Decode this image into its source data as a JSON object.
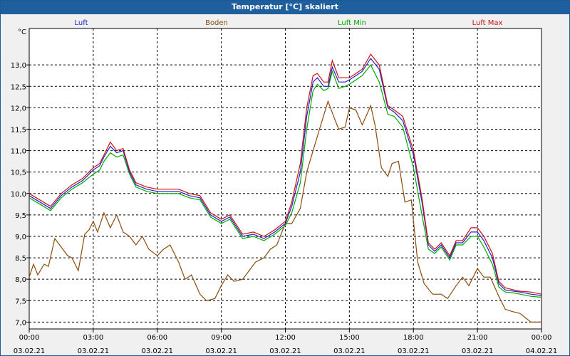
{
  "window_title": "Temperatur [°C] skaliert",
  "chart_data": {
    "type": "line",
    "title": "Temperatur [°C] skaliert",
    "ylabel": "°C",
    "xlabel": "",
    "ylim": [
      6.84,
      13.85
    ],
    "xlim_hours": [
      0,
      24
    ],
    "grid": true,
    "grid_style": "dashed",
    "legend_placement": "top",
    "y_ticks": [
      "13,0",
      "12,5",
      "12,0",
      "11,5",
      "11,0",
      "10,5",
      "10,0",
      "9,5",
      "9,0",
      "8,5",
      "8,0",
      "7,5",
      "7,0"
    ],
    "y_tick_values": [
      13.0,
      12.5,
      12.0,
      11.5,
      11.0,
      10.5,
      10.0,
      9.5,
      9.0,
      8.5,
      8.0,
      7.5,
      7.0
    ],
    "x_tick_times": [
      "00:00",
      "03:00",
      "06:00",
      "09:00",
      "12:00",
      "15:00",
      "18:00",
      "21:00",
      "00:00"
    ],
    "x_tick_dates": [
      "03.02.21",
      "03.02.21",
      "03.02.21",
      "03.02.21",
      "03.02.21",
      "03.02.21",
      "03.02.21",
      "03.02.21",
      "04.02.21"
    ],
    "x_tick_hours": [
      0,
      3,
      6,
      9,
      12,
      15,
      18,
      21,
      24
    ],
    "series": [
      {
        "name": "Luft",
        "color": "#2222cc",
        "x": [
          0,
          0.5,
          1,
          1.5,
          2,
          2.5,
          3,
          3.3,
          3.5,
          3.8,
          4.1,
          4.4,
          4.7,
          5,
          5.5,
          6,
          6.5,
          7,
          7.5,
          8,
          8.5,
          9,
          9.4,
          10,
          10.5,
          11,
          11.5,
          12,
          12.3,
          12.7,
          13,
          13.3,
          13.5,
          13.8,
          14,
          14.2,
          14.5,
          14.8,
          15,
          15.3,
          15.6,
          16,
          16.4,
          16.8,
          17.1,
          17.5,
          18,
          18.4,
          18.7,
          19,
          19.3,
          19.7,
          20,
          20.3,
          20.7,
          21,
          21.3,
          21.7,
          22,
          22.3,
          22.7,
          23,
          23.5,
          24
        ],
        "y": [
          9.95,
          9.8,
          9.65,
          9.95,
          10.15,
          10.3,
          10.55,
          10.65,
          10.85,
          11.1,
          10.95,
          11.0,
          10.5,
          10.2,
          10.1,
          10.05,
          10.05,
          10.05,
          9.95,
          9.9,
          9.5,
          9.35,
          9.45,
          9.0,
          9.05,
          8.95,
          9.1,
          9.3,
          9.7,
          10.5,
          11.8,
          12.6,
          12.7,
          12.5,
          12.5,
          12.95,
          12.6,
          12.6,
          12.65,
          12.75,
          12.85,
          13.15,
          12.9,
          12.0,
          11.9,
          11.7,
          10.9,
          9.8,
          8.8,
          8.65,
          8.8,
          8.5,
          8.85,
          8.85,
          9.1,
          9.1,
          8.9,
          8.5,
          7.9,
          7.75,
          7.72,
          7.7,
          7.65,
          7.62
        ]
      },
      {
        "name": "Boden",
        "color": "#8b4c0c",
        "x": [
          0,
          0.2,
          0.4,
          0.7,
          0.9,
          1.2,
          1.5,
          1.8,
          2,
          2.3,
          2.6,
          2.8,
          3,
          3.2,
          3.5,
          3.8,
          4.1,
          4.4,
          4.7,
          5,
          5.3,
          5.6,
          6,
          6.3,
          6.6,
          7,
          7.3,
          7.6,
          8,
          8.3,
          8.7,
          9,
          9.3,
          9.6,
          10,
          10.3,
          10.6,
          11,
          11.3,
          11.6,
          12,
          12.3,
          12.7,
          13,
          13.3,
          13.6,
          14,
          14.3,
          14.5,
          14.8,
          15,
          15.3,
          15.6,
          16,
          16.2,
          16.5,
          16.8,
          17,
          17.3,
          17.6,
          17.9,
          18.2,
          18.5,
          18.9,
          19.3,
          19.6,
          20,
          20.3,
          20.6,
          21,
          21.3,
          21.6,
          22,
          22.3,
          22.6,
          23,
          23.5,
          24
        ],
        "y": [
          8.05,
          8.35,
          8.1,
          8.35,
          8.3,
          8.95,
          8.75,
          8.55,
          8.5,
          8.2,
          9.05,
          9.15,
          9.35,
          9.1,
          9.55,
          9.2,
          9.5,
          9.1,
          9.0,
          8.8,
          9.0,
          8.7,
          8.55,
          8.7,
          8.8,
          8.4,
          8.0,
          8.1,
          7.65,
          7.5,
          7.55,
          7.85,
          8.1,
          7.95,
          8.0,
          8.2,
          8.4,
          8.5,
          8.7,
          8.8,
          9.3,
          9.3,
          9.65,
          10.5,
          11.0,
          11.5,
          12.15,
          11.75,
          11.5,
          11.55,
          12.0,
          11.95,
          11.6,
          12.05,
          11.6,
          10.6,
          10.4,
          10.7,
          10.75,
          9.8,
          9.85,
          8.4,
          7.9,
          7.65,
          7.65,
          7.55,
          7.85,
          8.05,
          7.85,
          8.25,
          8.05,
          8.05,
          7.6,
          7.3,
          7.25,
          7.2,
          7.0,
          7.0
        ]
      },
      {
        "name": "Luft Min",
        "color": "#00aa00",
        "x": [
          0,
          0.5,
          1,
          1.5,
          2,
          2.5,
          3,
          3.3,
          3.5,
          3.8,
          4.1,
          4.4,
          4.7,
          5,
          5.5,
          6,
          6.5,
          7,
          7.5,
          8,
          8.5,
          9,
          9.4,
          10,
          10.5,
          11,
          11.5,
          12,
          12.3,
          12.7,
          13,
          13.3,
          13.5,
          13.8,
          14,
          14.2,
          14.5,
          14.8,
          15,
          15.3,
          15.6,
          16,
          16.4,
          16.8,
          17.1,
          17.5,
          18,
          18.4,
          18.7,
          19,
          19.3,
          19.7,
          20,
          20.3,
          20.7,
          21,
          21.3,
          21.7,
          22,
          22.3,
          22.7,
          23,
          23.5,
          24
        ],
        "y": [
          9.9,
          9.75,
          9.6,
          9.9,
          10.1,
          10.25,
          10.45,
          10.55,
          10.75,
          10.95,
          10.85,
          10.9,
          10.45,
          10.15,
          10.05,
          10.0,
          10.0,
          10.0,
          9.9,
          9.85,
          9.45,
          9.3,
          9.4,
          8.95,
          9.0,
          8.9,
          9.05,
          9.25,
          9.55,
          10.25,
          11.5,
          12.4,
          12.55,
          12.4,
          12.45,
          12.85,
          12.45,
          12.5,
          12.55,
          12.65,
          12.75,
          13.0,
          12.6,
          11.85,
          11.8,
          11.55,
          10.6,
          9.5,
          8.7,
          8.6,
          8.75,
          8.45,
          8.8,
          8.8,
          9.0,
          9.0,
          8.75,
          8.35,
          7.82,
          7.7,
          7.68,
          7.65,
          7.6,
          7.58
        ]
      },
      {
        "name": "Luft Max",
        "color": "#cc1111",
        "x": [
          0,
          0.5,
          1,
          1.5,
          2,
          2.5,
          3,
          3.3,
          3.5,
          3.8,
          4.1,
          4.4,
          4.7,
          5,
          5.5,
          6,
          6.5,
          7,
          7.5,
          8,
          8.5,
          9,
          9.4,
          10,
          10.5,
          11,
          11.5,
          12,
          12.3,
          12.7,
          13,
          13.3,
          13.5,
          13.8,
          14,
          14.2,
          14.5,
          14.8,
          15,
          15.3,
          15.6,
          16,
          16.4,
          16.8,
          17.1,
          17.5,
          18,
          18.4,
          18.7,
          19,
          19.3,
          19.7,
          20,
          20.3,
          20.7,
          21,
          21.3,
          21.7,
          22,
          22.3,
          22.7,
          23,
          23.5,
          24
        ],
        "y": [
          10.0,
          9.85,
          9.7,
          10.0,
          10.2,
          10.35,
          10.6,
          10.7,
          10.9,
          11.2,
          11.0,
          11.05,
          10.55,
          10.25,
          10.15,
          10.1,
          10.1,
          10.1,
          10.0,
          9.95,
          9.55,
          9.4,
          9.5,
          9.05,
          9.1,
          9.0,
          9.15,
          9.35,
          9.8,
          10.7,
          12.0,
          12.75,
          12.8,
          12.6,
          12.6,
          13.1,
          12.7,
          12.7,
          12.7,
          12.8,
          12.9,
          13.25,
          13.0,
          12.05,
          11.95,
          11.8,
          11.0,
          9.9,
          8.85,
          8.7,
          8.85,
          8.55,
          8.9,
          8.9,
          9.2,
          9.2,
          9.0,
          8.6,
          7.95,
          7.8,
          7.75,
          7.72,
          7.7,
          7.65
        ]
      }
    ]
  }
}
